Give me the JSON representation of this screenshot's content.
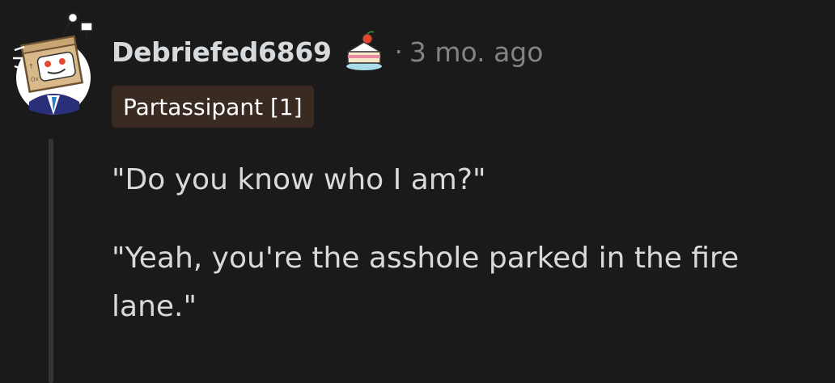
{
  "comment": {
    "author": "Debriefed6869",
    "cake_icon": "cake-day-icon",
    "separator": "·",
    "time_ago": "3 mo. ago",
    "flair": "Partassipant [1]",
    "paragraphs": [
      "\"Do you know who I am?\"",
      "\"Yeah, you're the asshole parked in the fire lane.\""
    ]
  },
  "colors": {
    "background": "#1a1a1b",
    "text": "#d7dadc",
    "meta": "#818384",
    "flair_bg": "#3a2b22",
    "thread_line": "#343536"
  }
}
